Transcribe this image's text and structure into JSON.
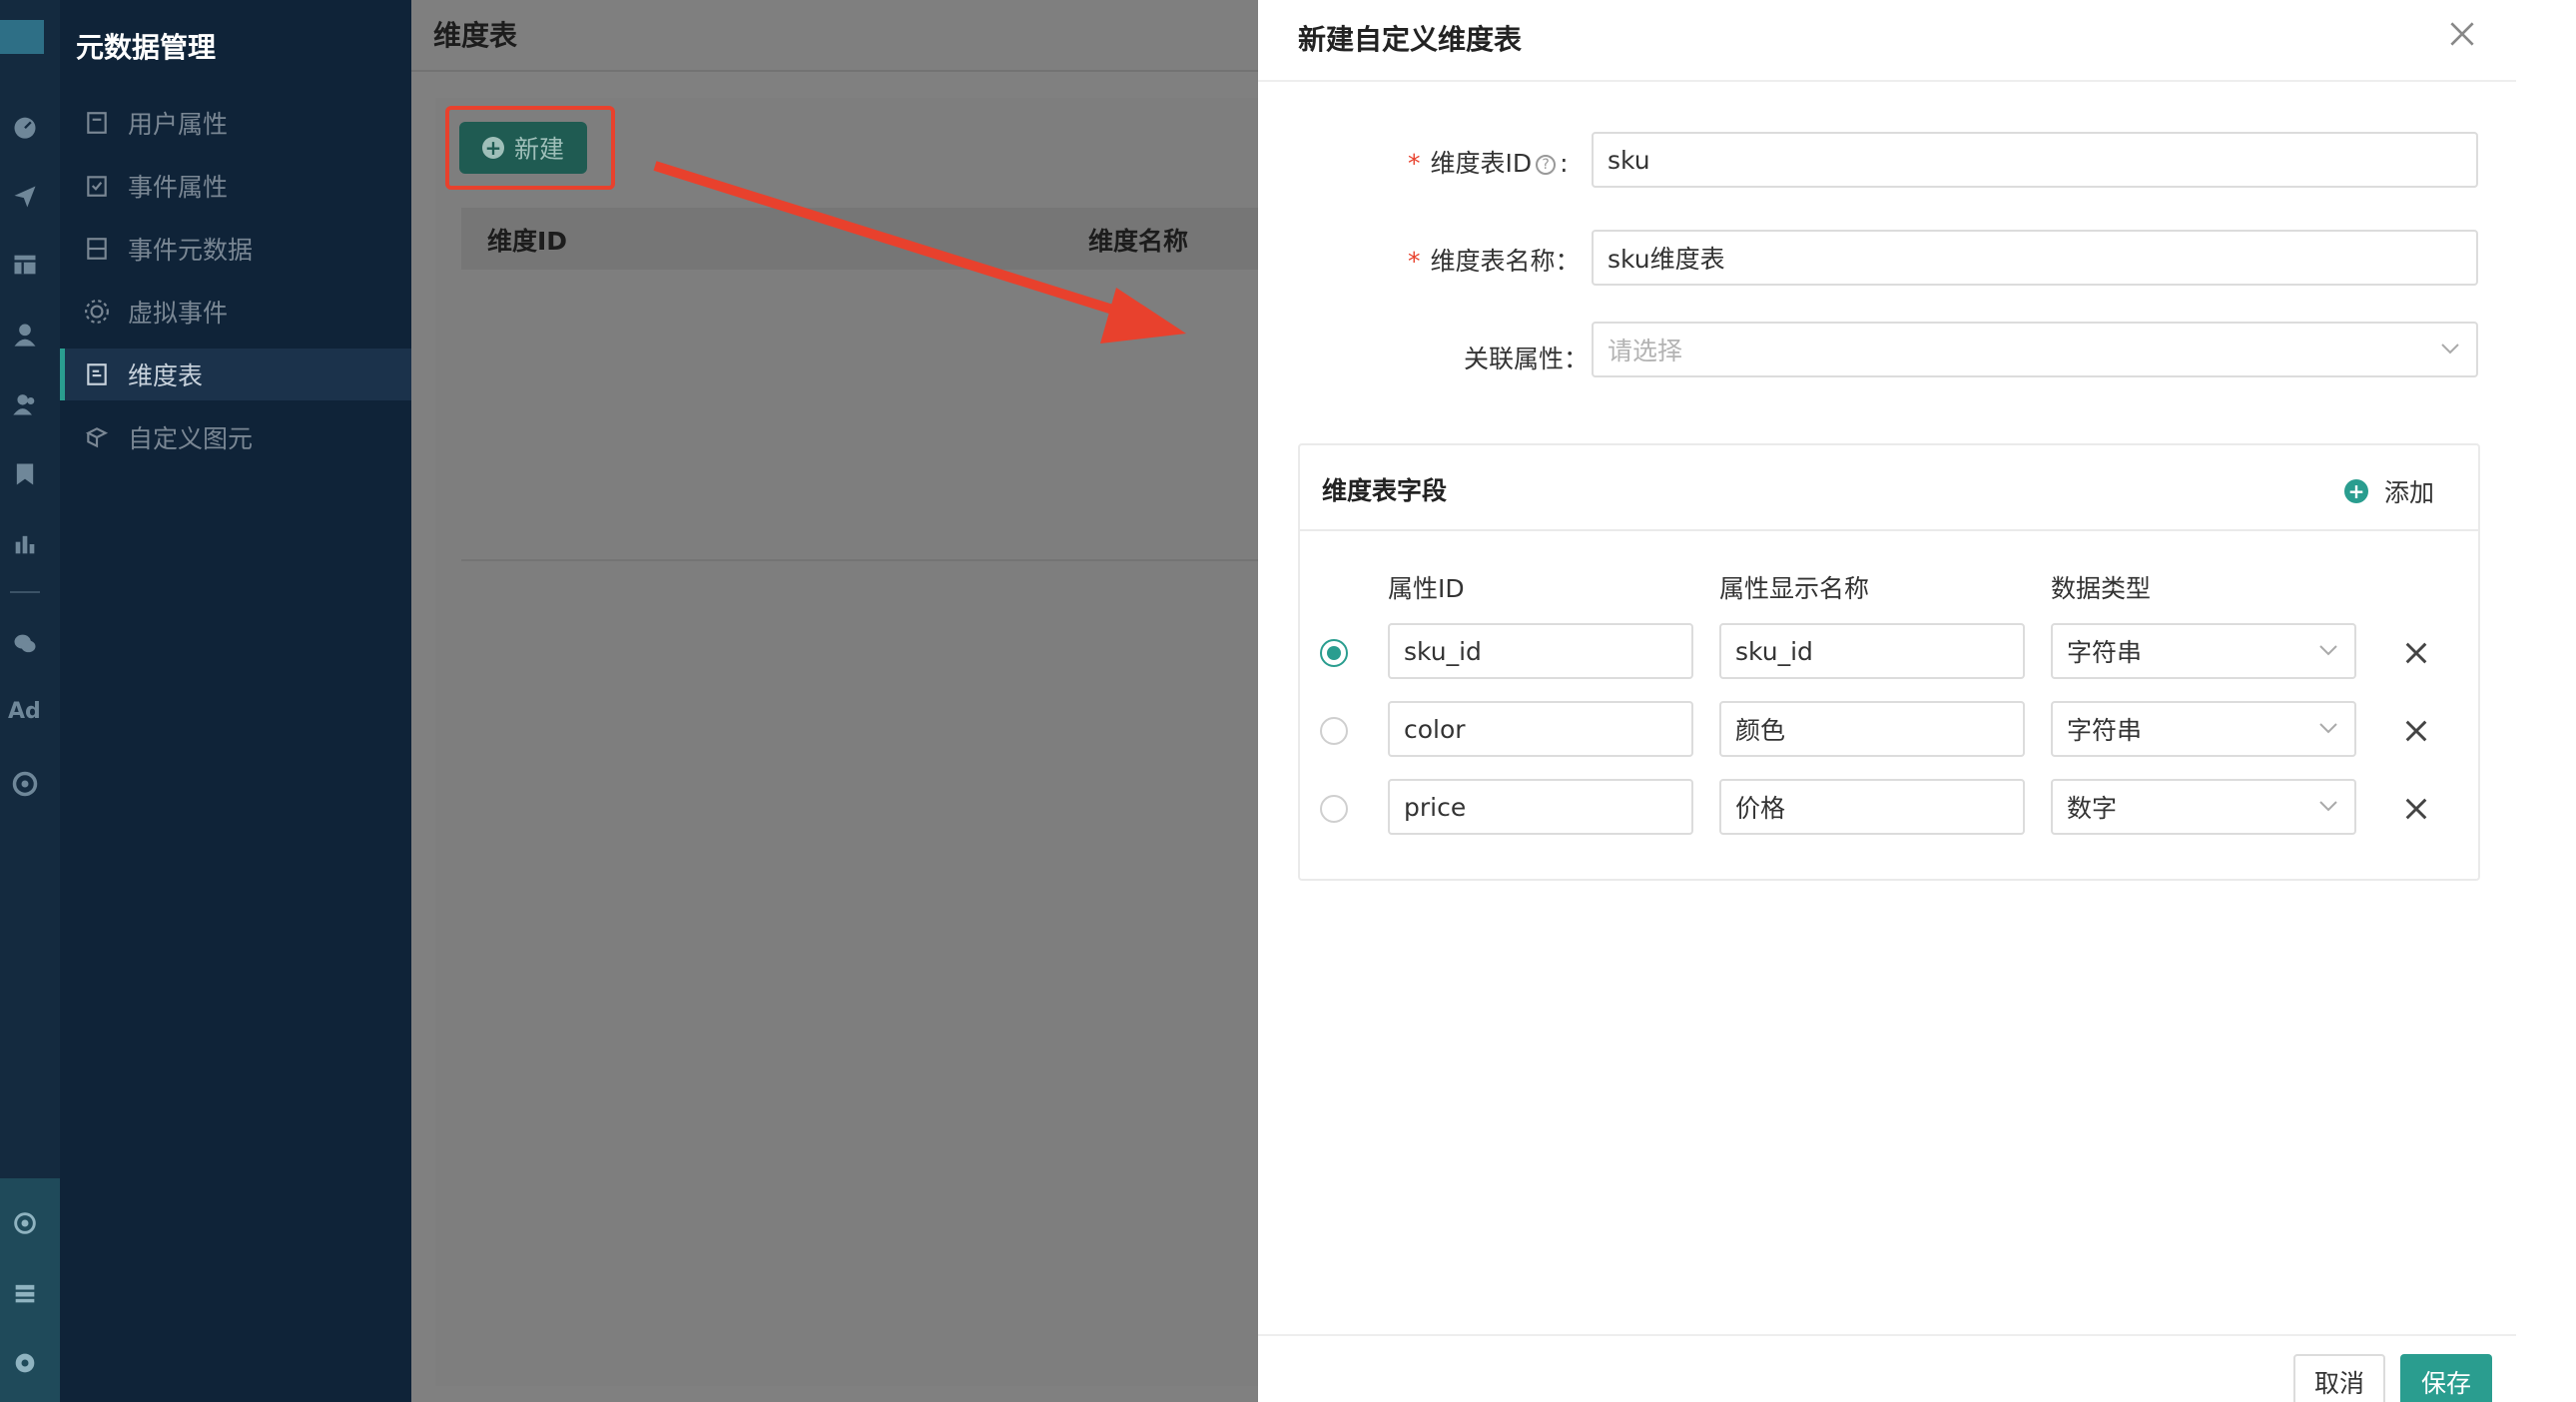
{
  "sidebar": {
    "title": "元数据管理",
    "items": [
      {
        "label": "用户属性",
        "icon": "user-attribute-icon"
      },
      {
        "label": "事件属性",
        "icon": "event-attribute-icon"
      },
      {
        "label": "事件元数据",
        "icon": "event-metadata-icon"
      },
      {
        "label": "虚拟事件",
        "icon": "virtual-event-icon"
      },
      {
        "label": "维度表",
        "icon": "dimension-table-icon",
        "active": true
      },
      {
        "label": "自定义图元",
        "icon": "custom-element-icon"
      }
    ],
    "rail_ad_label": "Ad"
  },
  "main": {
    "title": "维度表",
    "new_button": "新建",
    "table_headers": [
      "维度ID",
      "维度名称"
    ]
  },
  "drawer": {
    "title": "新建自定义维度表",
    "form": {
      "id_label": "维度表ID",
      "id_value": "sku",
      "name_label": "维度表名称：",
      "name_value": "sku维度表",
      "relation_label": "关联属性：",
      "relation_placeholder": "请选择"
    },
    "fields_card": {
      "title": "维度表字段",
      "add_label": "添加",
      "columns": [
        "属性ID",
        "属性显示名称",
        "数据类型"
      ],
      "rows": [
        {
          "selected": true,
          "id": "sku_id",
          "display": "sku_id",
          "type": "字符串"
        },
        {
          "selected": false,
          "id": "color",
          "display": "颜色",
          "type": "字符串"
        },
        {
          "selected": false,
          "id": "price",
          "display": "价格",
          "type": "数字"
        }
      ]
    },
    "footer": {
      "cancel": "取消",
      "save": "保存"
    }
  },
  "colors": {
    "accent": "#2a9d8f",
    "highlight_red": "#e8412d",
    "sidebar_bg": "#0f2338"
  }
}
